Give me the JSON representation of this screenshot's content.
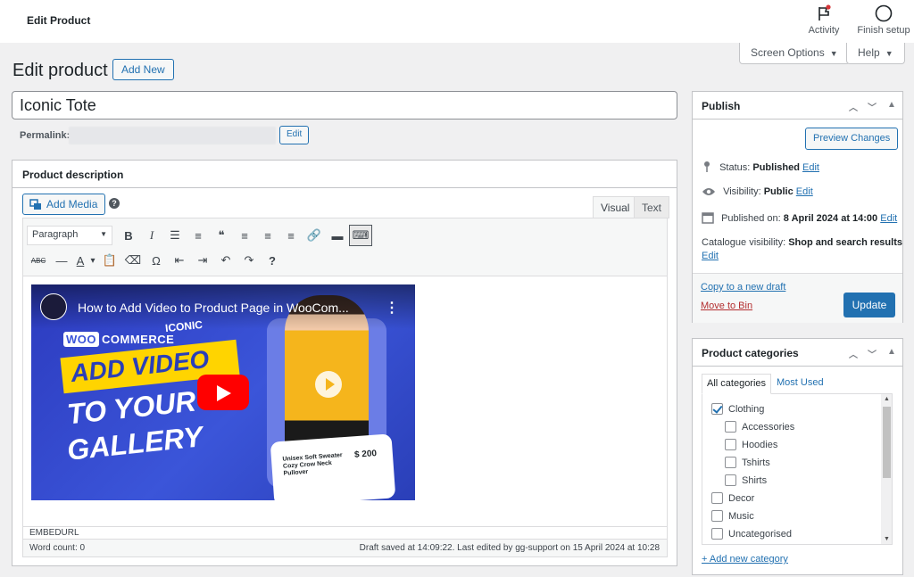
{
  "topbar": {
    "title": "Edit Product",
    "activity_label": "Activity",
    "finish_label": "Finish setup"
  },
  "screen_options": {
    "label": "Screen Options",
    "caret": "▼"
  },
  "help": {
    "label": "Help",
    "caret": "▼"
  },
  "heading": {
    "title": "Edit product",
    "add_new": "Add New"
  },
  "product": {
    "title": "Iconic Tote",
    "permalink_label": "Permalink:",
    "permalink_edit": "Edit"
  },
  "description": {
    "title": "Product description",
    "add_media": "Add Media",
    "help_glyph": "?",
    "tab_visual": "Visual",
    "tab_text": "Text",
    "format_select": "Paragraph",
    "format_caret": "▼",
    "toolbar_row1": [
      {
        "name": "bold-icon",
        "glyph": "B"
      },
      {
        "name": "italic-icon",
        "glyph": "I"
      },
      {
        "name": "bullet-list-icon",
        "glyph": "☰"
      },
      {
        "name": "numbered-list-icon",
        "glyph": "≡"
      },
      {
        "name": "blockquote-icon",
        "glyph": "❝"
      },
      {
        "name": "align-left-icon",
        "glyph": "≡"
      },
      {
        "name": "align-center-icon",
        "glyph": "≡"
      },
      {
        "name": "align-right-icon",
        "glyph": "≡"
      },
      {
        "name": "link-icon",
        "glyph": "🔗"
      },
      {
        "name": "read-more-icon",
        "glyph": "▬"
      },
      {
        "name": "toolbar-toggle-icon",
        "glyph": "⌨"
      }
    ],
    "toolbar_row2": [
      {
        "name": "strikethrough-icon",
        "glyph": "ABC"
      },
      {
        "name": "horizontal-line-icon",
        "glyph": "—"
      },
      {
        "name": "text-color-icon",
        "glyph": "A"
      },
      {
        "name": "text-color-caret-icon",
        "glyph": "▾"
      },
      {
        "name": "paste-text-icon",
        "glyph": "📋"
      },
      {
        "name": "clear-formatting-icon",
        "glyph": "⌫"
      },
      {
        "name": "special-character-icon",
        "glyph": "Ω"
      },
      {
        "name": "outdent-icon",
        "glyph": "⇤"
      },
      {
        "name": "indent-icon",
        "glyph": "⇥"
      },
      {
        "name": "undo-icon",
        "glyph": "↶"
      },
      {
        "name": "redo-icon",
        "glyph": "↷"
      },
      {
        "name": "keyboard-shortcuts-icon",
        "glyph": "?"
      }
    ],
    "video": {
      "title": "How to Add Video to Product Page in WooCom...",
      "dots": "⋮",
      "woo_badge": "WOO",
      "woo_text": "COMMERCE",
      "iconic_brand": "ICONIC",
      "line1": "ADD VIDEO",
      "line2": "TO YOUR",
      "line3": "GALLERY",
      "card_name": "Unisex Soft Sweater Cozy Crow Neck Pullover",
      "card_price": "$ 200"
    },
    "status_path": "EMBEDURL",
    "word_count": "Word count: 0",
    "draft_saved": "Draft saved at 14:09:22. Last edited by gg-support on 15 April 2024 at 10:28"
  },
  "publish": {
    "title": "Publish",
    "preview": "Preview Changes",
    "status_label": "Status:",
    "status_value": "Published",
    "visibility_label": "Visibility:",
    "visibility_value": "Public",
    "published_label": "Published on:",
    "published_value": "8 April 2024 at 14:00",
    "catalogue_label": "Catalogue visibility:",
    "catalogue_value": "Shop and search results",
    "edit": "Edit",
    "copy_draft": "Copy to a new draft",
    "move_bin": "Move to Bin",
    "update": "Update"
  },
  "categories": {
    "title": "Product categories",
    "tab_all": "All categories",
    "tab_most_used": "Most Used",
    "items": [
      {
        "label": "Clothing",
        "checked": true,
        "level": 0
      },
      {
        "label": "Accessories",
        "checked": false,
        "level": 1
      },
      {
        "label": "Hoodies",
        "checked": false,
        "level": 1
      },
      {
        "label": "Tshirts",
        "checked": false,
        "level": 1
      },
      {
        "label": "Shirts",
        "checked": false,
        "level": 1
      },
      {
        "label": "Decor",
        "checked": false,
        "level": 0
      },
      {
        "label": "Music",
        "checked": false,
        "level": 0
      },
      {
        "label": "Uncategorised",
        "checked": false,
        "level": 0
      }
    ],
    "add_new": "+ Add new category"
  },
  "colors": {
    "accent": "#2271b1",
    "danger": "#b32d2e",
    "youtube": "#ff0000",
    "notification_dot": "#d63638"
  }
}
